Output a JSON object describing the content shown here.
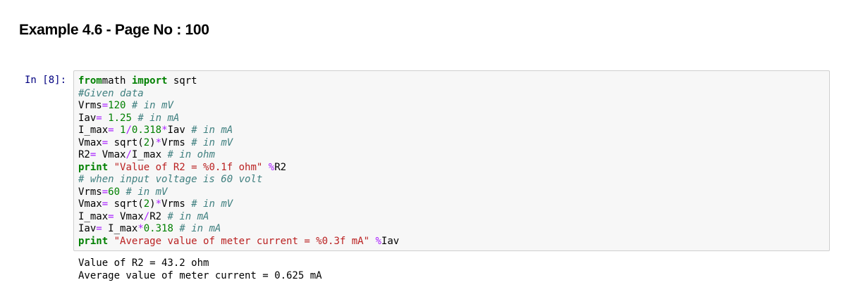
{
  "notebook": {
    "heading": "Example 4.6 - Page No : 100",
    "cell": {
      "prompt": "In [8]:",
      "code": [
        [
          [
            "kw",
            "from"
          ],
          [
            "",
            "math "
          ],
          [
            "kw",
            "import"
          ],
          [
            "",
            " sqrt"
          ]
        ],
        [
          [
            "cm",
            "#Given data"
          ]
        ],
        [
          [
            "",
            "Vrms"
          ],
          [
            "op",
            "="
          ],
          [
            "num",
            "120"
          ],
          [
            "",
            " "
          ],
          [
            "cm",
            "# in mV"
          ]
        ],
        [
          [
            "",
            "Iav"
          ],
          [
            "op",
            "="
          ],
          [
            "",
            " "
          ],
          [
            "num",
            "1.25"
          ],
          [
            "",
            " "
          ],
          [
            "cm",
            "# in mA"
          ]
        ],
        [
          [
            "",
            "I_max"
          ],
          [
            "op",
            "="
          ],
          [
            "",
            " "
          ],
          [
            "num",
            "1"
          ],
          [
            "op",
            "/"
          ],
          [
            "num",
            "0.318"
          ],
          [
            "op",
            "*"
          ],
          [
            "",
            "Iav "
          ],
          [
            "cm",
            "# in mA"
          ]
        ],
        [
          [
            "",
            "Vmax"
          ],
          [
            "op",
            "="
          ],
          [
            "",
            " sqrt("
          ],
          [
            "num",
            "2"
          ],
          [
            "",
            ")"
          ],
          [
            "op",
            "*"
          ],
          [
            "",
            "Vrms "
          ],
          [
            "cm",
            "# in mV"
          ]
        ],
        [
          [
            "",
            "R2"
          ],
          [
            "op",
            "="
          ],
          [
            "",
            " Vmax"
          ],
          [
            "op",
            "/"
          ],
          [
            "",
            "I_max "
          ],
          [
            "cm",
            "# in ohm"
          ]
        ],
        [
          [
            "kw",
            "print"
          ],
          [
            "",
            " "
          ],
          [
            "st",
            "\"Value of R2 = %0.1f ohm\""
          ],
          [
            "",
            " "
          ],
          [
            "op",
            "%"
          ],
          [
            "",
            "R2"
          ]
        ],
        [
          [
            "cm",
            "# when input voltage is 60 volt"
          ]
        ],
        [
          [
            "",
            "Vrms"
          ],
          [
            "op",
            "="
          ],
          [
            "num",
            "60"
          ],
          [
            "",
            " "
          ],
          [
            "cm",
            "# in mV"
          ]
        ],
        [
          [
            "",
            "Vmax"
          ],
          [
            "op",
            "="
          ],
          [
            "",
            " sqrt("
          ],
          [
            "num",
            "2"
          ],
          [
            "",
            ")"
          ],
          [
            "op",
            "*"
          ],
          [
            "",
            "Vrms "
          ],
          [
            "cm",
            "# in mV"
          ]
        ],
        [
          [
            "",
            "I_max"
          ],
          [
            "op",
            "="
          ],
          [
            "",
            " Vmax"
          ],
          [
            "op",
            "/"
          ],
          [
            "",
            "R2 "
          ],
          [
            "cm",
            "# in mA"
          ]
        ],
        [
          [
            "",
            "Iav"
          ],
          [
            "op",
            "="
          ],
          [
            "",
            " I_max"
          ],
          [
            "op",
            "*"
          ],
          [
            "num",
            "0.318"
          ],
          [
            "",
            " "
          ],
          [
            "cm",
            "# in mA"
          ]
        ],
        [
          [
            "kw",
            "print"
          ],
          [
            "",
            " "
          ],
          [
            "st",
            "\"Average value of meter current = %0.3f mA\""
          ],
          [
            "",
            " "
          ],
          [
            "op",
            "%"
          ],
          [
            "",
            "Iav"
          ]
        ]
      ],
      "output": [
        "Value of R2 = 43.2 ohm",
        "Average value of meter current = 0.625 mA"
      ]
    }
  }
}
